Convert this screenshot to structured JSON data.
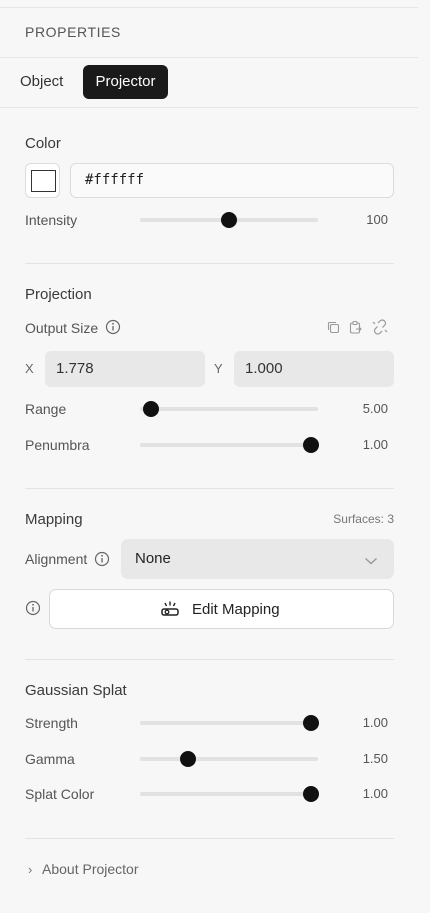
{
  "header": {
    "title": "PROPERTIES"
  },
  "tabs": [
    {
      "label": "Object",
      "active": false
    },
    {
      "label": "Projector",
      "active": true
    }
  ],
  "color": {
    "title": "Color",
    "swatch_color": "#ffffff",
    "hex_value": "#ffffff",
    "intensity": {
      "label": "Intensity",
      "value": "100",
      "fraction": 0.5
    }
  },
  "projection": {
    "title": "Projection",
    "output_size_label": "Output Size",
    "x_label": "X",
    "x_value": "1.778",
    "y_label": "Y",
    "y_value": "1.000",
    "range": {
      "label": "Range",
      "value": "5.00",
      "fraction": 0.06
    },
    "penumbra": {
      "label": "Penumbra",
      "value": "1.00",
      "fraction": 0.96
    },
    "icons": [
      "copy-icon",
      "paste-icon",
      "unlink-icon"
    ]
  },
  "mapping": {
    "title": "Mapping",
    "surfaces": "Surfaces: 3",
    "alignment_label": "Alignment",
    "alignment_value": "None",
    "edit_label": "Edit Mapping"
  },
  "gaussian": {
    "title": "Gaussian Splat",
    "strength": {
      "label": "Strength",
      "value": "1.00",
      "fraction": 0.96
    },
    "gamma": {
      "label": "Gamma",
      "value": "1.50",
      "fraction": 0.27
    },
    "splat_color": {
      "label": "Splat Color",
      "value": "1.00",
      "fraction": 0.96
    }
  },
  "footer": {
    "about_label": "About Projector"
  },
  "colors": {
    "accent": "#1a1a1a",
    "panel_bg": "#f7f7f7",
    "input_bg": "#e8e8e8"
  }
}
